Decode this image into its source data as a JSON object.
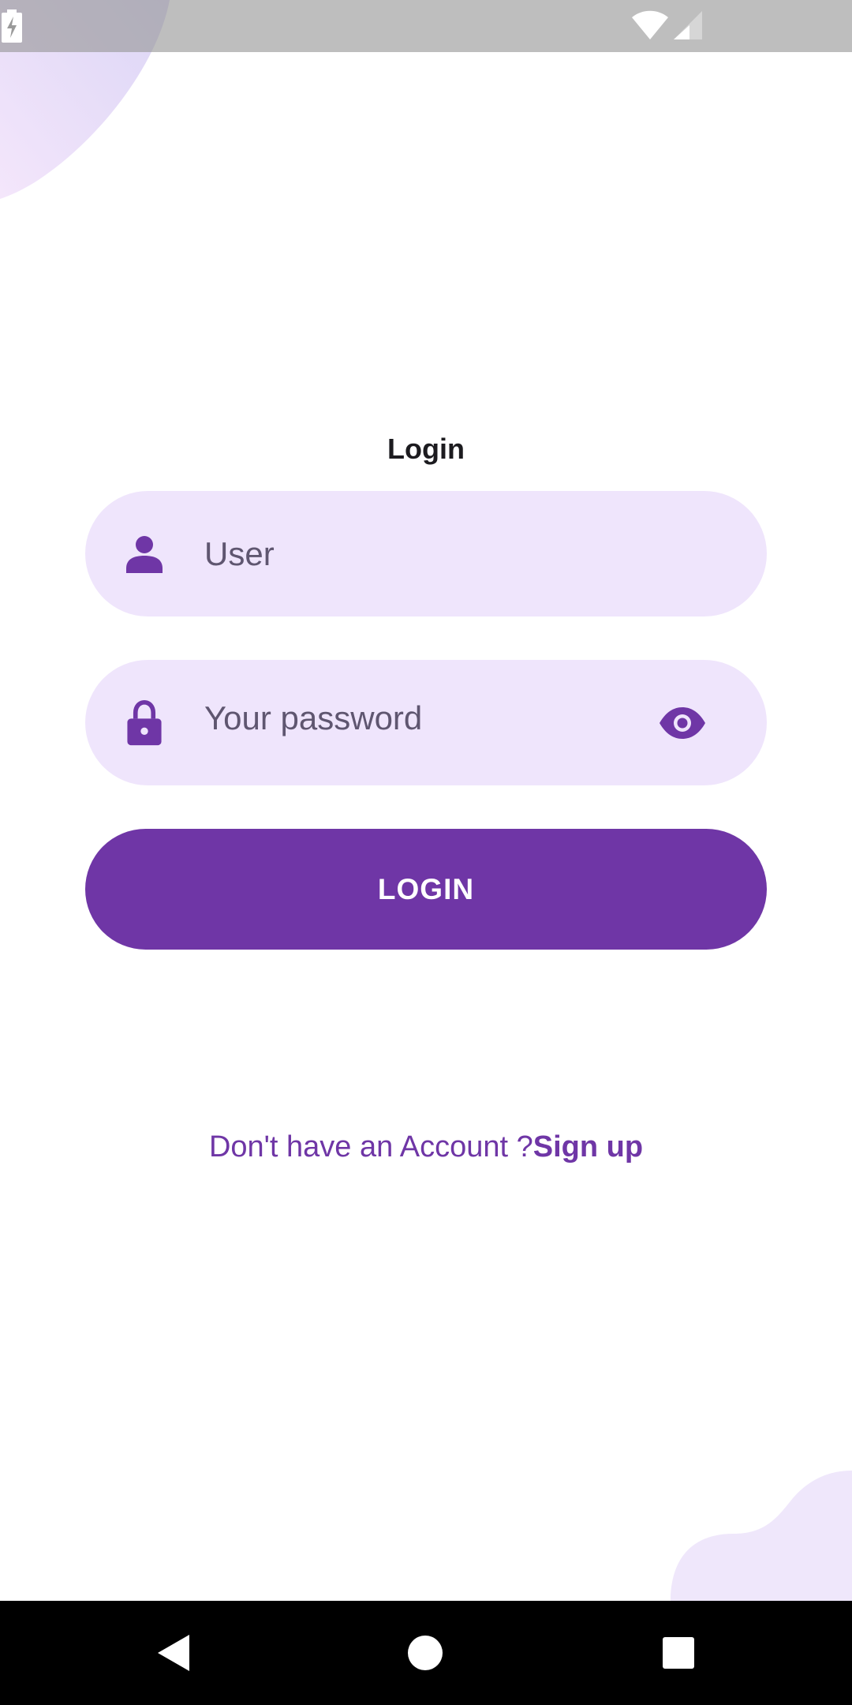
{
  "login_form": {
    "title": "Login",
    "user_placeholder": "User",
    "password_placeholder": "Your password",
    "submit_label": "LOGIN",
    "signup_prompt": "Don't have an Account ?",
    "signup_link": "Sign up"
  },
  "icons": {
    "user_field": "person-icon",
    "password_field": "lock-icon",
    "password_toggle": "eye-icon",
    "status": [
      "wifi-icon",
      "signal-icon",
      "battery-charging-icon"
    ],
    "navigation": [
      "back-icon",
      "home-icon",
      "recent-apps-icon"
    ]
  },
  "colors": {
    "accent": "#6f36a6",
    "field_background": "#efe5fc",
    "placeholder_text": "#5f5670",
    "title_text": "#1c1b1f",
    "nav_bar": "#000000"
  }
}
